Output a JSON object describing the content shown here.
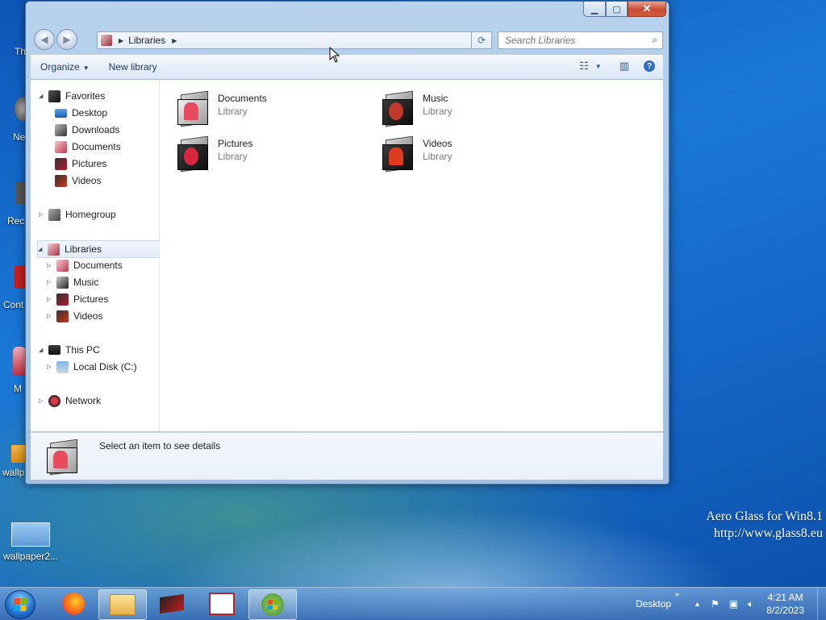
{
  "desktop": {
    "icons": [
      {
        "label": "Th"
      },
      {
        "label": "Ne"
      },
      {
        "label": "Rec"
      },
      {
        "label": "Cont"
      },
      {
        "label": "M"
      },
      {
        "label": "wallp"
      }
    ],
    "wallpaper_file": "wallpaper2...",
    "watermark_line1": "Aero Glass for Win8.1",
    "watermark_line2": "http://www.glass8.eu"
  },
  "window": {
    "address": {
      "crumb": "Libraries"
    },
    "search": {
      "placeholder": "Search Libraries"
    },
    "toolbar": {
      "organize": "Organize",
      "new_library": "New library"
    },
    "nav": {
      "favorites": "Favorites",
      "favorites_items": [
        "Desktop",
        "Downloads",
        "Documents",
        "Pictures",
        "Videos"
      ],
      "homegroup": "Homegroup",
      "libraries": "Libraries",
      "libraries_items": [
        "Documents",
        "Music",
        "Pictures",
        "Videos"
      ],
      "this_pc": "This PC",
      "local_disk": "Local Disk (C:)",
      "network": "Network"
    },
    "libraries": [
      {
        "name": "Documents",
        "type": "Library",
        "color": "#e84a5f"
      },
      {
        "name": "Music",
        "type": "Library",
        "color": "#c0392b"
      },
      {
        "name": "Pictures",
        "type": "Library",
        "color": "#d7263d"
      },
      {
        "name": "Videos",
        "type": "Library",
        "color": "#e03a1e"
      }
    ],
    "details_text": "Select an item to see details"
  },
  "taskbar": {
    "show_desktop_label": "Desktop",
    "time": "4:21 AM",
    "date": "8/2/2023"
  }
}
